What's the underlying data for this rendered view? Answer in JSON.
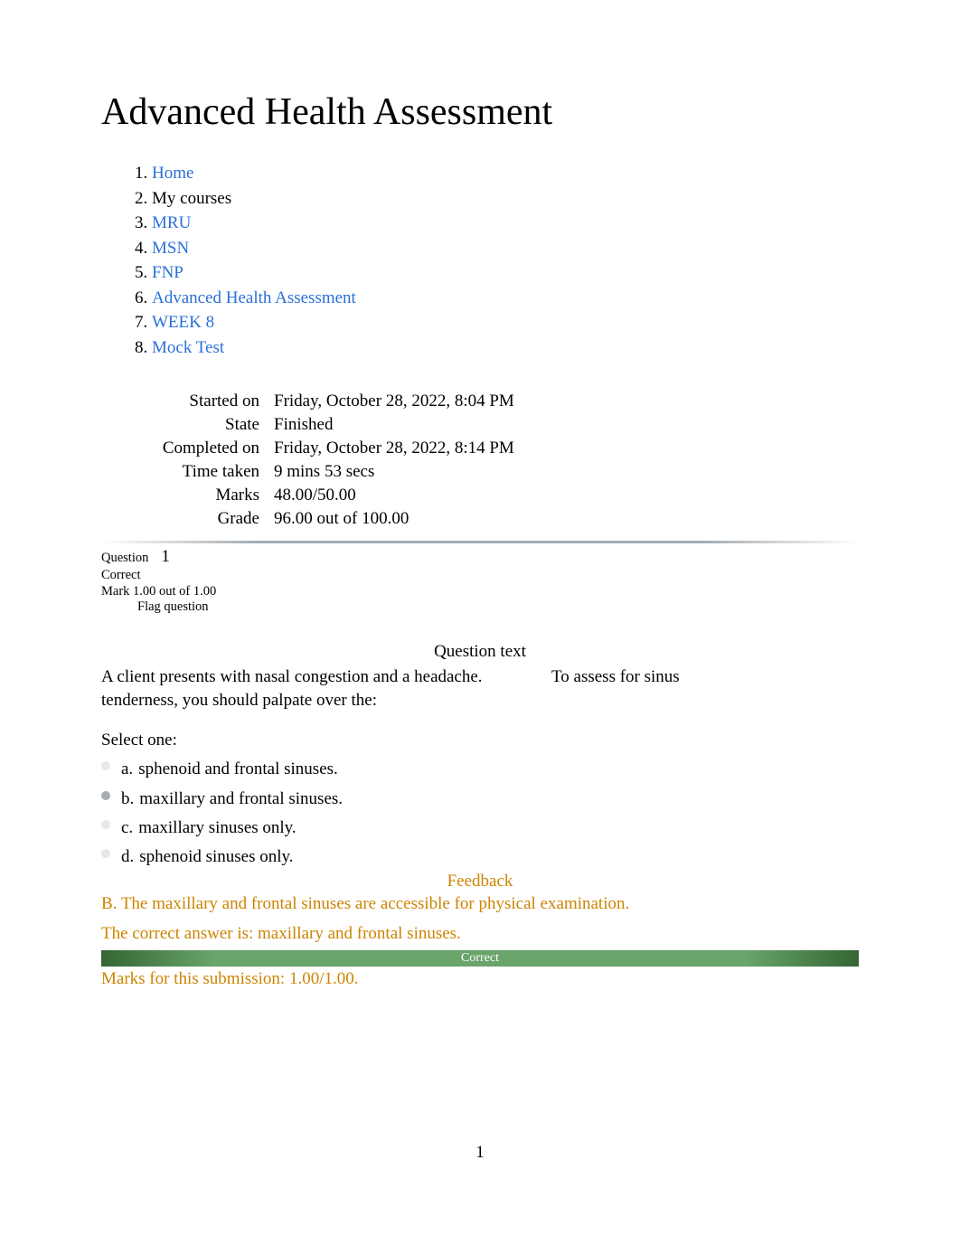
{
  "page_title": "Advanced Health Assessment",
  "breadcrumb": {
    "items": [
      {
        "label": "Home",
        "link": true
      },
      {
        "label": "My courses",
        "link": false
      },
      {
        "label": "MRU",
        "link": true
      },
      {
        "label": "MSN",
        "link": true
      },
      {
        "label": "FNP",
        "link": true
      },
      {
        "label": "Advanced Health Assessment",
        "link": true
      },
      {
        "label": "WEEK 8",
        "link": true
      },
      {
        "label": "Mock Test",
        "link": true
      }
    ]
  },
  "summary": {
    "started_on_label": "Started on",
    "started_on_value": "Friday, October 28, 2022, 8:04 PM",
    "state_label": "State",
    "state_value": "Finished",
    "completed_on_label": "Completed on",
    "completed_on_value": "Friday, October 28, 2022, 8:14 PM",
    "time_taken_label": "Time taken",
    "time_taken_value": "9 mins 53 secs",
    "marks_label": "Marks",
    "marks_value": "48.00/50.00",
    "grade_label": "Grade",
    "grade_value": "96.00 out of 100.00"
  },
  "question": {
    "label": "Question",
    "number": "1",
    "correctness": "Correct",
    "mark_text": "Mark 1.00 out of 1.00",
    "flag_text": "Flag question",
    "question_text_heading": "Question text",
    "prompt_part1": "A client presents with nasal congestion and a headache.",
    "prompt_part2": "To assess for sinus",
    "prompt_line2": "tenderness, you should palpate over the:",
    "select_one": "Select one:",
    "options": [
      {
        "label": "a.",
        "text": "sphenoid and frontal sinuses."
      },
      {
        "label": "b.",
        "text": "maxillary and frontal sinuses."
      },
      {
        "label": "c.",
        "text": "maxillary sinuses only."
      },
      {
        "label": "d.",
        "text": "sphenoid sinuses only."
      }
    ],
    "feedback_heading": "Feedback",
    "feedback_rationale": "B. The maxillary and frontal sinuses are accessible for physical examination.",
    "correct_answer_text": "The correct answer is: maxillary and frontal sinuses.",
    "correct_bar": "Correct",
    "submission_marks": "Marks for this submission: 1.00/1.00."
  },
  "page_number": "1"
}
